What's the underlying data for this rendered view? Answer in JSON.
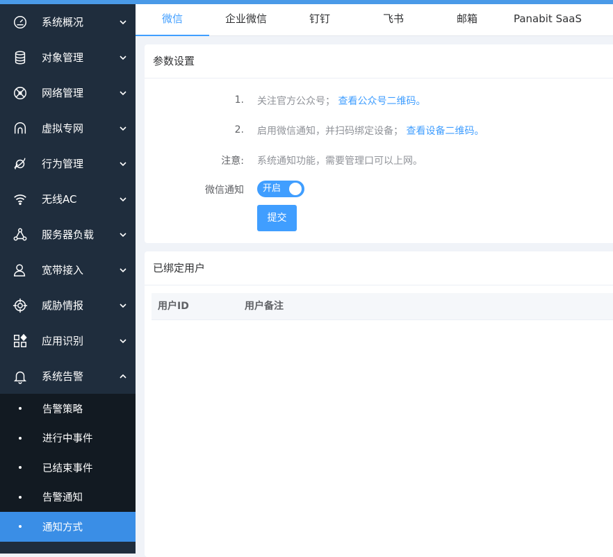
{
  "sidebar": {
    "items": [
      {
        "label": "系统概况",
        "icon": "gauge-icon",
        "expanded": false
      },
      {
        "label": "对象管理",
        "icon": "database-icon",
        "expanded": false
      },
      {
        "label": "网络管理",
        "icon": "network-icon",
        "expanded": false
      },
      {
        "label": "虚拟专网",
        "icon": "tunnel-icon",
        "expanded": false
      },
      {
        "label": "行为管理",
        "icon": "planet-icon",
        "expanded": false
      },
      {
        "label": "无线AC",
        "icon": "wifi-icon",
        "expanded": false
      },
      {
        "label": "服务器负载",
        "icon": "nodes-icon",
        "expanded": false
      },
      {
        "label": "宽带接入",
        "icon": "user-icon",
        "expanded": false
      },
      {
        "label": "威胁情报",
        "icon": "crosshair-icon",
        "expanded": false
      },
      {
        "label": "应用识别",
        "icon": "apps-icon",
        "expanded": false
      },
      {
        "label": "系统告警",
        "icon": "bell-icon",
        "expanded": true
      }
    ],
    "sub_items": [
      {
        "label": "告警策略",
        "active": false
      },
      {
        "label": "进行中事件",
        "active": false
      },
      {
        "label": "已结束事件",
        "active": false
      },
      {
        "label": "告警通知",
        "active": false
      },
      {
        "label": "通知方式",
        "active": true
      }
    ]
  },
  "tabs": [
    {
      "label": "微信",
      "active": true
    },
    {
      "label": "企业微信",
      "active": false
    },
    {
      "label": "钉钉",
      "active": false
    },
    {
      "label": "飞书",
      "active": false
    },
    {
      "label": "邮箱",
      "active": false
    },
    {
      "label": "Panabit SaaS",
      "active": false
    }
  ],
  "params": {
    "title": "参数设置",
    "step1_num": "1.",
    "step1_text": "关注官方公众号；",
    "step1_link": "查看公众号二维码",
    "step1_end": "。",
    "step2_num": "2.",
    "step2_text": "启用微信通知，并扫码绑定设备；",
    "step2_link": "查看设备二维码",
    "step2_end": "。",
    "note_key": "注意:",
    "note_text": "系统通知功能，需要管理口可以上网。",
    "notify_key": "微信通知",
    "switch_label": "开启",
    "switch_on": true,
    "submit_label": "提交"
  },
  "bound_users": {
    "title": "已绑定用户",
    "columns": [
      "用户ID",
      "用户备注"
    ],
    "rows": []
  },
  "colors": {
    "accent": "#409eff",
    "sidebar_bg": "#1f2d3d",
    "submenu_bg": "#121a22",
    "active_sub": "#3a8ee6"
  }
}
